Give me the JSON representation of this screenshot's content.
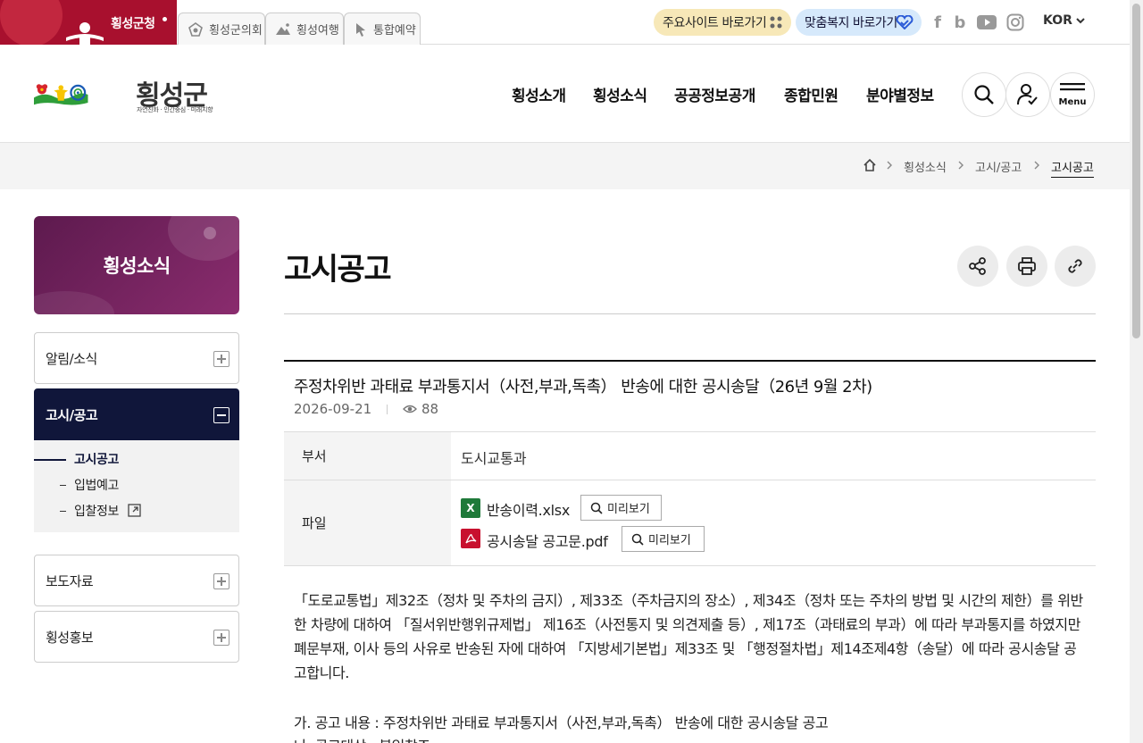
{
  "topbar": {
    "main_site": "횡성군청",
    "sites": [
      "횡성군의회",
      "횡성여행",
      "통합예약"
    ],
    "quick_links": [
      "주요사이트 바로가기",
      "맞춤복지 바로가기"
    ],
    "sns_icons": [
      "facebook-icon",
      "blog-icon",
      "youtube-icon",
      "instagram-icon"
    ],
    "language": "KOR"
  },
  "header": {
    "logo_name": "횡성군",
    "logo_slogan": "자연친화 · 인간중심 · 미래지향",
    "nav": [
      "횡성소개",
      "횡성소식",
      "공공정보공개",
      "종합민원",
      "분야별정보"
    ],
    "menu_label": "Menu"
  },
  "breadcrumb": [
    "횡성소식",
    "고시/공고",
    "고시공고"
  ],
  "sidebar": {
    "title": "횡성소식",
    "items": [
      "알림/소식",
      "고시/공고",
      "보도자료",
      "횡성홍보"
    ],
    "sub_items": [
      "고시공고",
      "입법예고",
      "입찰정보"
    ]
  },
  "content": {
    "page_title": "고시공고",
    "post": {
      "title": "주정차위반 과태료 부과통지서（사전,부과,독촉） 반송에 대한 공시송달（26년 9월 2차)",
      "date": "2026-09-21",
      "views": "88",
      "dept_label": "부서",
      "dept": "도시교통과",
      "file_label": "파일",
      "files": [
        {
          "name": "반송이력.xlsx",
          "type": "excel"
        },
        {
          "name": "공시송달 공고문.pdf",
          "type": "pdf"
        }
      ],
      "preview_label": "미리보기",
      "body": "「도로교통법」제32조（정차 및 주차의 금지）, 제33조（주차금지의 장소）, 제34조（정차 또는 주차의 방법 및 시간의 제한）를 위반한 차량에 대하여 「질서위반행위규제법」 제16조（사전통지 및 의견제출 등）, 제17조（과태료의 부과）에 따라 부과통지를 하였지만 폐문부재, 이사 등의 사유로 반송된 자에 대하여 「지방세기본법」제33조 및 「행정절차법」제14조제4항（송달）에 따라 공시송달 공고합니다.",
      "item_a": "가. 공고 내용 : 주정차위반 과태료 부과통지서（사전,부과,독촉） 반송에 대한 공시송달 공고",
      "item_b": "나. 공고대상 : 붙임참조"
    }
  },
  "colors": {
    "brand_red": "#a8102e",
    "nav_active": "#10163a",
    "side_title_purple": "#6e2260"
  }
}
